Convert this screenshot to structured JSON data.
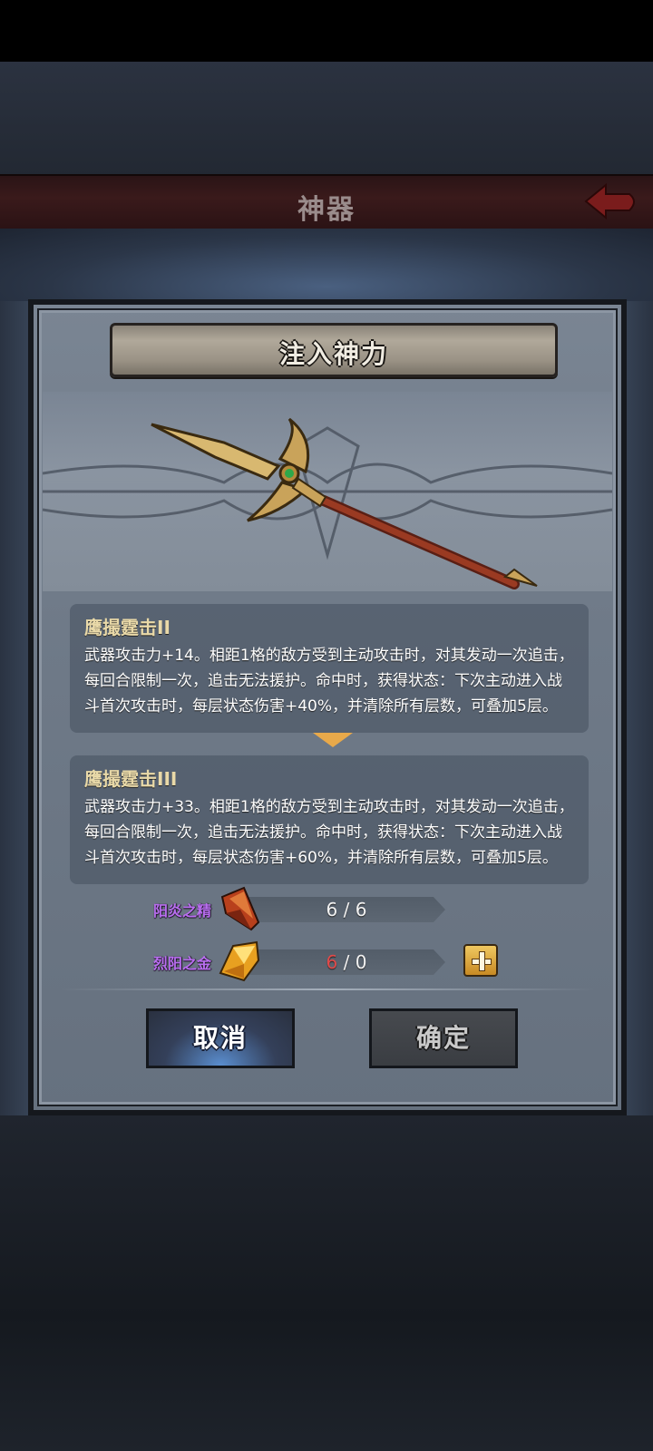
{
  "header": {
    "title": "神器"
  },
  "dialog": {
    "title": "注入神力",
    "current_skill": {
      "name": "鹰撮霆击II",
      "description": "武器攻击力+14。相距1格的敌方受到主动攻击时，对其发动一次追击，每回合限制一次，追击无法援护。命中时，获得状态：下次主动进入战斗首次攻击时，每层状态伤害+40%，并清除所有层数，可叠加5层。"
    },
    "next_skill": {
      "name": "鹰撮霆击III",
      "description": "武器攻击力+33。相距1格的敌方受到主动攻击时，对其发动一次追击，每回合限制一次，追击无法援护。命中时，获得状态：下次主动进入战斗首次攻击时，每层状态伤害+60%，并清除所有层数，可叠加5层。"
    },
    "materials": [
      {
        "name": "阳炎之精",
        "have": "6",
        "need": "6",
        "icon": "red-crystal-icon"
      },
      {
        "name": "烈阳之金",
        "have": "6",
        "need": "0",
        "icon": "gold-crystal-icon"
      }
    ],
    "cancel_label": "取消",
    "confirm_label": "确定"
  },
  "colors": {
    "header_bg": "#3a1a1b",
    "dialog_bg": "#6f7a88",
    "material_label": "#b96ef0",
    "insufficient": "#e04a4a",
    "arrow": "#e8a94a"
  }
}
